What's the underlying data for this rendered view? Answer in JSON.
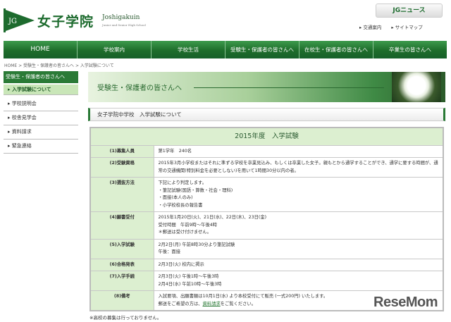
{
  "logo": {
    "mark": "JG",
    "name_jp": "女子学院",
    "name_en": "Joshigakuin",
    "subtitle": "Junior and Senior High School"
  },
  "header": {
    "news_button": "JGニュース",
    "links": [
      "交通案内",
      "サイトマップ"
    ]
  },
  "nav": [
    "HOME",
    "学校案内",
    "学校生活",
    "受験生・保護者の皆さんへ",
    "在校生・保護者の皆さんへ",
    "卒業生の皆さんへ"
  ],
  "breadcrumb": "HOME > 受験生・保護者の皆さんへ > 入学試験について",
  "sidebar": {
    "heading": "受験生・保護者の皆さんへ",
    "items": [
      "入学試験について",
      "学校説明会",
      "校舎見学会",
      "資料請求",
      "緊急連絡"
    ]
  },
  "banner": {
    "title": "受験生・保護者の皆さんへ"
  },
  "page_title": "女子学院中学校　入学試験について",
  "table": {
    "caption": "2015年度　入学試験",
    "rows": [
      {
        "label": "(1)募集人員",
        "lines": [
          "第1学年　240名"
        ]
      },
      {
        "label": "(2)受験資格",
        "lines": [
          "2015年3月小学校またはそれに準ずる学校を卒業見込み、もしくは卒業した女子。親もとから通学することができ、通学に要する時間が、通常の交通機関(特別料金を必要としない)を用いて1時間30分以内の者。"
        ]
      },
      {
        "label": "(3)選抜方法",
        "lines": [
          "下記により判定します。",
          "・筆記試験(国語・算数・社会・理科)",
          "・面接(本人のみ)",
          "・小学校校長の報告書"
        ]
      },
      {
        "label": "(4)願書受付",
        "lines": [
          "2015年1月20日(火)、21日(水)、22日(木)、23日(金)",
          "受付時間　午前9時～午後4時",
          "＊郵送は受け付けません。"
        ]
      },
      {
        "label": "(5)入学試験",
        "lines": [
          "2月2日(月) 午前8時30分より筆記試験",
          "午後：面接"
        ]
      },
      {
        "label": "(6)合格発表",
        "lines": [
          "2月3日(火) 校内に掲示"
        ]
      },
      {
        "label": "(7)入学手続",
        "lines": [
          "2月3日(火) 午後1時～午後3時",
          "2月4日(水) 午前10時～午後3時"
        ]
      },
      {
        "label": "(8)備考",
        "lines": [
          "入試要項、出願書類は10月1日(水) より本校受付にて販売 (一式200円) いたします。"
        ],
        "last_pre": "郵送をご希望の方は、",
        "last_link": "資料請求",
        "last_post": "をご覧ください。"
      }
    ]
  },
  "footnote": "※高校の募集は行っておりません。",
  "watermark": "ReseMom"
}
